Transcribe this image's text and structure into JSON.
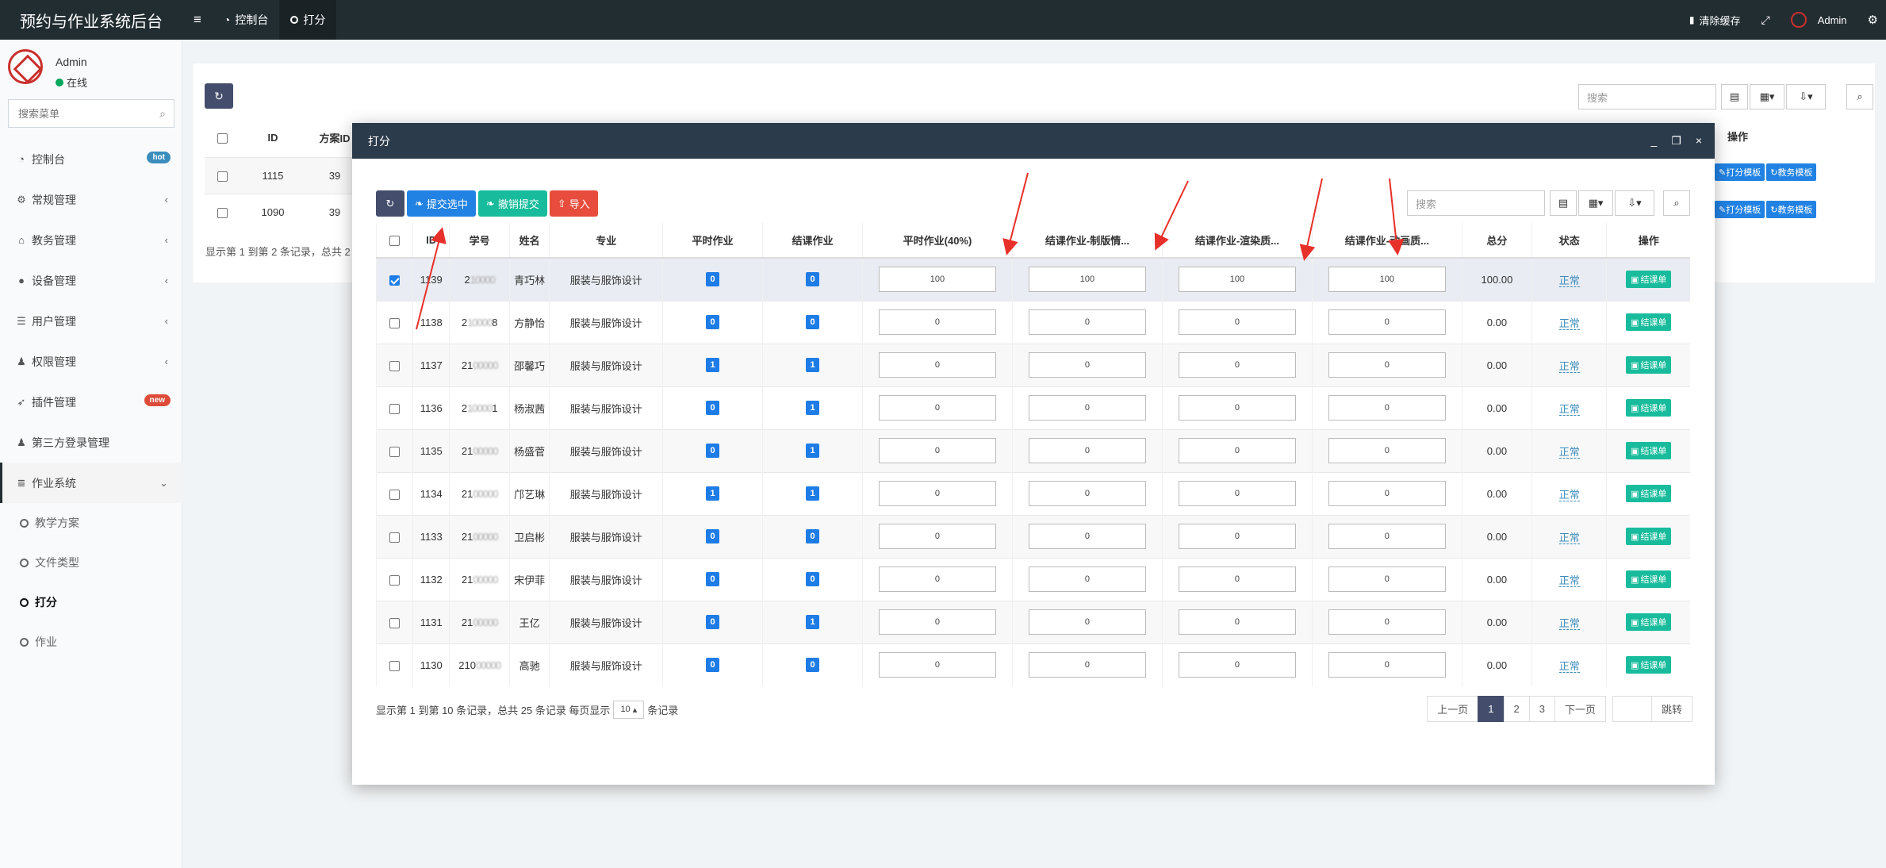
{
  "app": {
    "title": "预约与作业系统后台"
  },
  "top_nav": {
    "dashboard": "控制台",
    "active_tab": "打分"
  },
  "top_right": {
    "clear_cache": "清除缓存",
    "admin": "Admin"
  },
  "user": {
    "name": "Admin",
    "status": "在线"
  },
  "sidebar": {
    "search_placeholder": "搜索菜单",
    "items": [
      {
        "label": "控制台",
        "badge": "hot",
        "badge_color": "#3c8dbc"
      },
      {
        "label": "常规管理"
      },
      {
        "label": "教务管理"
      },
      {
        "label": "设备管理"
      },
      {
        "label": "用户管理"
      },
      {
        "label": "权限管理"
      },
      {
        "label": "插件管理",
        "badge": "new",
        "badge_color": "#dd4b39"
      },
      {
        "label": "第三方登录管理"
      },
      {
        "label": "作业系统"
      }
    ],
    "sub_items": [
      "教学方案",
      "文件类型",
      "打分",
      "作业"
    ]
  },
  "background": {
    "search_placeholder": "搜索",
    "headers": {
      "id": "ID",
      "plan_id": "方案ID",
      "ops": "操作"
    },
    "rows": [
      {
        "id": "1115",
        "plan": "39"
      },
      {
        "id": "1090",
        "plan": "39"
      }
    ],
    "btn_score_tpl": "打分模板",
    "btn_edu_tpl": "教务模板",
    "info": "显示第 1 到第 2 条记录，总共 2"
  },
  "modal": {
    "title": "打分",
    "toolbar": {
      "submit_selected": "提交选中",
      "cancel_submit": "撤销提交",
      "import": "导入"
    },
    "search_placeholder": "搜索",
    "headers": [
      "ID",
      "学号",
      "姓名",
      "专业",
      "平时作业",
      "结课作业",
      "平时作业(40%)",
      "结课作业-制版情...",
      "结课作业-渲染质...",
      "结课作业-动画质...",
      "总分",
      "状态",
      "操作"
    ],
    "rows": [
      {
        "id": "1139",
        "sid_prefix": "2",
        "sid_blur": "10000",
        "name": "青巧林",
        "major": "服装与服饰设计",
        "pingshi": "0",
        "jieke": "0",
        "s1": "100",
        "s2": "100",
        "s3": "100",
        "s4": "100",
        "total": "100.00",
        "status": "正常",
        "checked": true
      },
      {
        "id": "1138",
        "sid_prefix": "2",
        "sid_blur": "10000",
        "sid_suffix": "8",
        "name": "方静怡",
        "major": "服装与服饰设计",
        "pingshi": "0",
        "jieke": "0",
        "s1": "0",
        "s2": "0",
        "s3": "0",
        "s4": "0",
        "total": "0.00",
        "status": "正常"
      },
      {
        "id": "1137",
        "sid_prefix": "21",
        "sid_blur": "00000",
        "name": "邵馨巧",
        "major": "服装与服饰设计",
        "pingshi": "1",
        "jieke": "1",
        "s1": "0",
        "s2": "0",
        "s3": "0",
        "s4": "0",
        "total": "0.00",
        "status": "正常"
      },
      {
        "id": "1136",
        "sid_prefix": "2",
        "sid_blur": "10000",
        "sid_suffix": "1",
        "name": "杨淑茜",
        "major": "服装与服饰设计",
        "pingshi": "0",
        "jieke": "1",
        "s1": "0",
        "s2": "0",
        "s3": "0",
        "s4": "0",
        "total": "0.00",
        "status": "正常"
      },
      {
        "id": "1135",
        "sid_prefix": "21",
        "sid_blur": "00000",
        "name": "杨盛菅",
        "major": "服装与服饰设计",
        "pingshi": "0",
        "jieke": "1",
        "s1": "0",
        "s2": "0",
        "s3": "0",
        "s4": "0",
        "total": "0.00",
        "status": "正常"
      },
      {
        "id": "1134",
        "sid_prefix": "21",
        "sid_blur": "00000",
        "name": "邝艺琳",
        "major": "服装与服饰设计",
        "pingshi": "1",
        "jieke": "1",
        "s1": "0",
        "s2": "0",
        "s3": "0",
        "s4": "0",
        "total": "0.00",
        "status": "正常"
      },
      {
        "id": "1133",
        "sid_prefix": "21",
        "sid_blur": "00000",
        "name": "卫启彬",
        "major": "服装与服饰设计",
        "pingshi": "0",
        "jieke": "0",
        "s1": "0",
        "s2": "0",
        "s3": "0",
        "s4": "0",
        "total": "0.00",
        "status": "正常"
      },
      {
        "id": "1132",
        "sid_prefix": "21",
        "sid_blur": "00000",
        "name": "宋伊菲",
        "major": "服装与服饰设计",
        "pingshi": "0",
        "jieke": "0",
        "s1": "0",
        "s2": "0",
        "s3": "0",
        "s4": "0",
        "total": "0.00",
        "status": "正常"
      },
      {
        "id": "1131",
        "sid_prefix": "21",
        "sid_blur": "00000",
        "name": "王亿",
        "major": "服装与服饰设计",
        "pingshi": "0",
        "jieke": "1",
        "s1": "0",
        "s2": "0",
        "s3": "0",
        "s4": "0",
        "total": "0.00",
        "status": "正常"
      },
      {
        "id": "1130",
        "sid_prefix": "210",
        "sid_blur": "00000",
        "name": "高驰",
        "major": "服装与服饰设计",
        "pingshi": "0",
        "jieke": "0",
        "s1": "0",
        "s2": "0",
        "s3": "0",
        "s4": "0",
        "total": "0.00",
        "status": "正常"
      }
    ],
    "op_label": "结课单",
    "footer": {
      "info": "显示第 1 到第 10 条记录，总共 25 条记录 每页显示",
      "page_size": "10",
      "suffix": "条记录"
    },
    "pager": {
      "prev": "上一页",
      "pages": [
        "1",
        "2",
        "3"
      ],
      "next": "下一页",
      "jump": "跳转"
    }
  },
  "colors": {
    "header_dark": "#222d32",
    "accent_blue": "#1e7ce6",
    "green": "#18bc9c",
    "red": "#e74c3c",
    "annotation_red": "#e8302a"
  }
}
